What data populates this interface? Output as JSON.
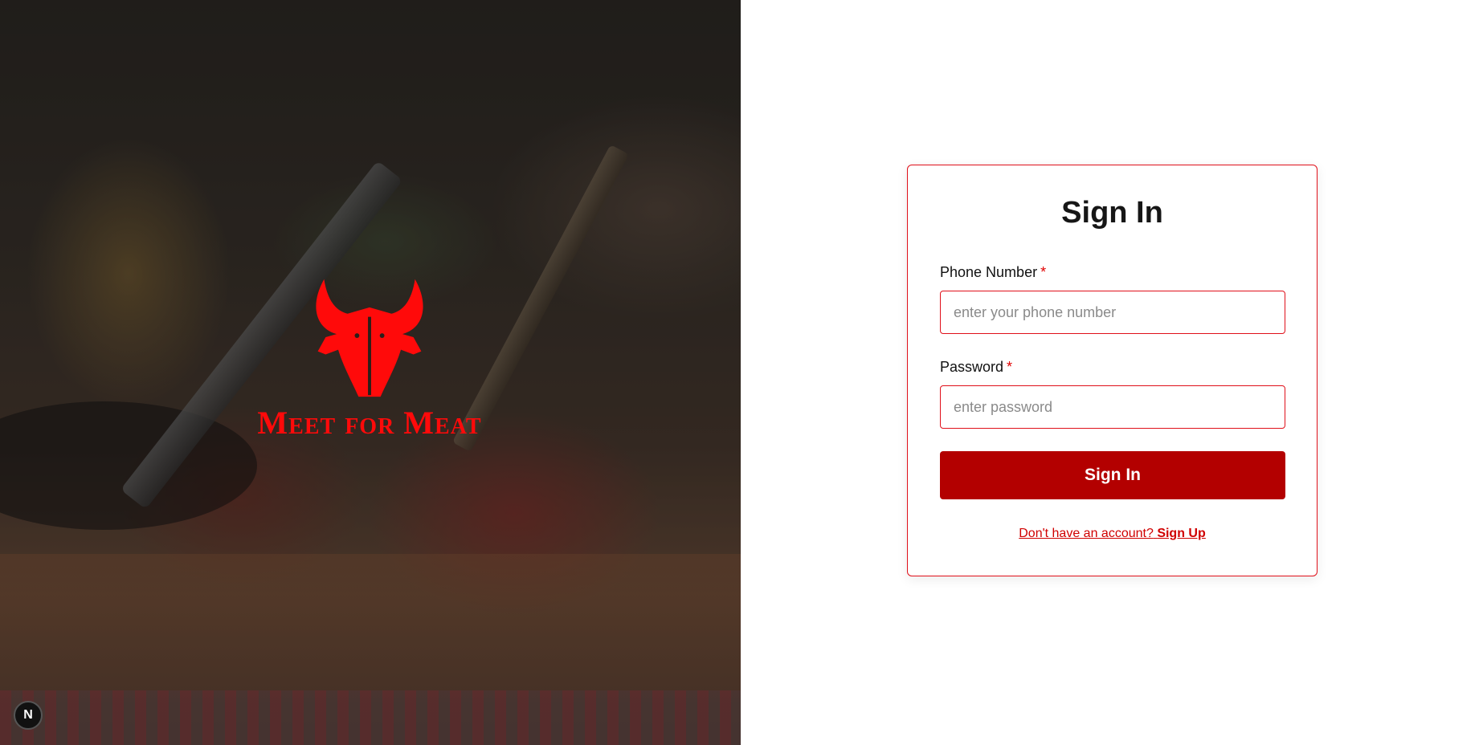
{
  "hero": {
    "brand_name": "Meet for Meat",
    "logo_icon": "bull-head-icon",
    "brand_color": "#ff0a0a"
  },
  "corner_badge": {
    "label": "N",
    "icon": "next-logo-icon"
  },
  "signin_form": {
    "title": "Sign In",
    "phone": {
      "label": "Phone Number",
      "required_mark": "*",
      "placeholder": "enter your phone number",
      "value": ""
    },
    "password": {
      "label": "Password",
      "required_mark": "*",
      "placeholder": "enter password",
      "value": ""
    },
    "submit_label": "Sign In",
    "signup_prompt": "Don't have an account?",
    "signup_link": "Sign Up"
  },
  "colors": {
    "accent": "#e0101a",
    "button": "#b30000",
    "link": "#d00000"
  }
}
